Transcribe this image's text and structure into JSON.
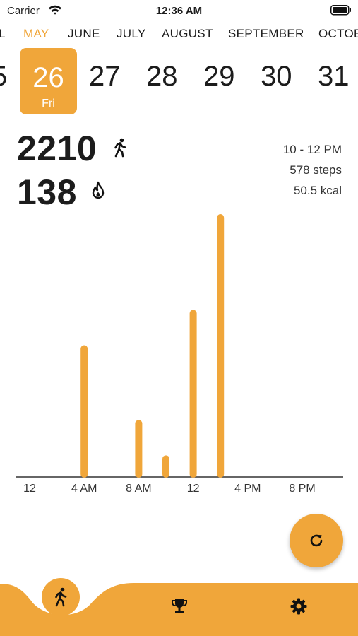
{
  "status_bar": {
    "carrier": "Carrier",
    "time": "12:36 AM"
  },
  "months": [
    {
      "label": "L",
      "active": false
    },
    {
      "label": "MAY",
      "active": true
    },
    {
      "label": "JUNE",
      "active": false
    },
    {
      "label": "JULY",
      "active": false
    },
    {
      "label": "AUGUST",
      "active": false
    },
    {
      "label": "SEPTEMBER",
      "active": false
    },
    {
      "label": "OCTOB",
      "active": false
    }
  ],
  "days": [
    "5",
    "27",
    "28",
    "29",
    "30",
    "31"
  ],
  "selected_day": {
    "number": "26",
    "weekday": "Fri"
  },
  "summary": {
    "steps_total": "2210",
    "calories_total": "138"
  },
  "selection_detail": {
    "range": "10 - 12 PM",
    "steps": "578 steps",
    "kcal": "50.5 kcal"
  },
  "colors": {
    "accent": "#f0a63a"
  },
  "icons": {
    "steps": "walking-icon",
    "calories": "flame-icon",
    "refresh": "refresh-icon",
    "nav_activity": "walking-icon",
    "nav_trophy": "trophy-icon",
    "nav_settings": "gear-icon"
  },
  "chart_data": {
    "type": "bar",
    "x_unit": "hour of day",
    "x_ticks": [
      "12",
      "4 AM",
      "8 AM",
      "12",
      "4 PM",
      "8 PM"
    ],
    "x_tick_hours": [
      0,
      4,
      8,
      12,
      16,
      20
    ],
    "bars": [
      {
        "hour": 4,
        "steps": 500
      },
      {
        "hour": 8,
        "steps": 215
      },
      {
        "hour": 10,
        "steps": 80
      },
      {
        "hour": 12,
        "steps": 635
      },
      {
        "hour": 14,
        "steps": 1000
      }
    ],
    "ylim": [
      0,
      1000
    ],
    "grid": false
  }
}
